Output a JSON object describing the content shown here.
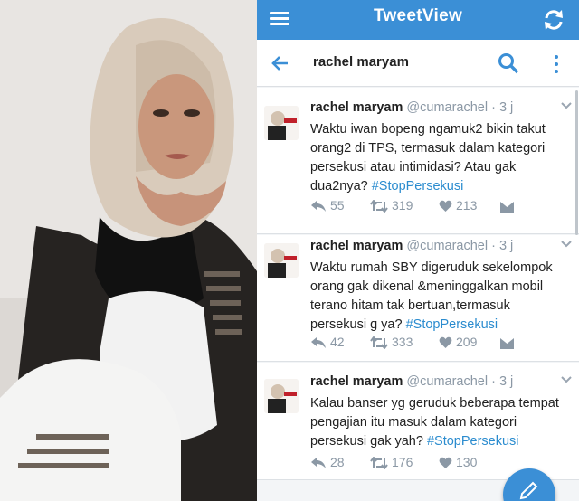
{
  "app": {
    "title": "TweetView",
    "search_query": "rachel maryam",
    "accent_color": "#3b8fd6",
    "link_color": "#2b8ccf"
  },
  "tweets": [
    {
      "name": "rachel maryam",
      "handle": "@cumarachel",
      "time": "· 3 j",
      "text": "Waktu iwan bopeng ngamuk2 bikin takut orang2 di TPS, termasuk dalam kategori persekusi atau intimidasi? Atau gak dua2nya? ",
      "hashtag": "#StopPersekusi",
      "replies": "55",
      "retweets": "319",
      "likes": "213",
      "avatar_text": "ANIES"
    },
    {
      "name": "rachel maryam",
      "handle": "@cumarachel",
      "time": "· 3 j",
      "text": "Waktu rumah SBY digeruduk sekelompok orang gak dikenal &meninggalkan mobil terano hitam tak bertuan,termasuk persekusi g ya? ",
      "hashtag": "#StopPersekusi",
      "replies": "42",
      "retweets": "333",
      "likes": "209",
      "avatar_text": "ANIES"
    },
    {
      "name": "rachel maryam",
      "handle": "@cumarachel",
      "time": "· 3 j",
      "text": "Kalau banser yg geruduk beberapa tempat pengajian itu masuk dalam kategori persekusi gak yah? ",
      "hashtag": "#StopPersekusi",
      "replies": "28",
      "retweets": "176",
      "likes": "130",
      "avatar_text": "ANIES"
    }
  ],
  "icons": {
    "menu": "menu-icon",
    "refresh": "refresh-icon",
    "back": "back-arrow-icon",
    "search": "search-icon",
    "more": "more-vert-icon",
    "reply": "reply-icon",
    "retweet": "retweet-icon",
    "like": "heart-icon",
    "dm": "direct-message-icon",
    "compose": "compose-icon"
  }
}
